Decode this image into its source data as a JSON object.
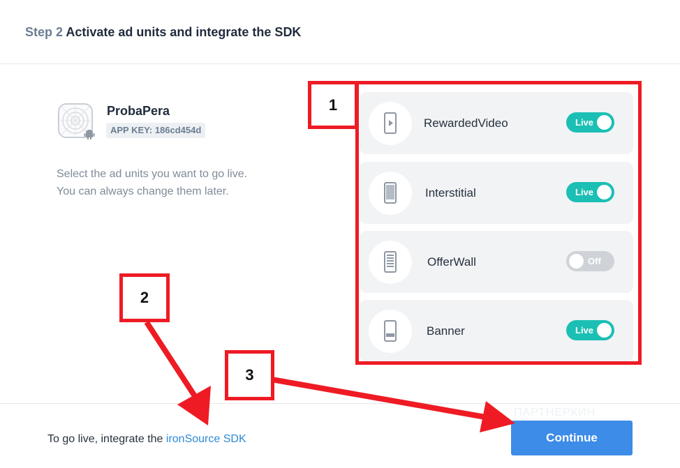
{
  "header": {
    "step_number": "Step 2",
    "step_title": "Activate ad units and integrate the SDK"
  },
  "app": {
    "name": "ProbaPera",
    "app_key": "APP KEY: 186cd454d",
    "platform_icon": "android-icon",
    "app_icon": "app-placeholder-icon"
  },
  "hint": {
    "line1": "Select the ad units you want to go live.",
    "line2": "You can always change them later."
  },
  "ad_units": [
    {
      "label": "RewardedVideo",
      "icon": "video-phone-icon",
      "status": "Live",
      "enabled": true
    },
    {
      "label": "Interstitial",
      "icon": "phone-fullscreen-icon",
      "status": "Live",
      "enabled": true
    },
    {
      "label": "OfferWall",
      "icon": "phone-list-icon",
      "status": "Off",
      "enabled": false
    },
    {
      "label": "Banner",
      "icon": "phone-banner-icon",
      "status": "Live",
      "enabled": true
    }
  ],
  "footer": {
    "text": "To go live, integrate the",
    "link": "ironSource SDK",
    "continue_label": "Continue",
    "watermark": "ПАРТНЕРКИН"
  },
  "annotations": {
    "badge_1": "1",
    "badge_2": "2",
    "badge_3": "3"
  },
  "colors": {
    "toggle_on": "#1bbfb4",
    "toggle_off": "#cfd3d8",
    "primary_button": "#3d8ce8",
    "link": "#2d8ad5",
    "annotation_red": "#ee1b24"
  }
}
